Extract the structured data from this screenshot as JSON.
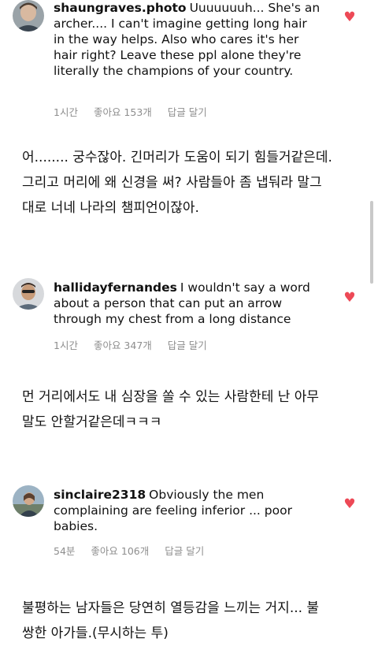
{
  "comments": [
    {
      "username": "shaungraves.photo",
      "text": "Uuuuuuuh... She's an archer.... I can't imagine getting long hair in the way helps. Also who cares it's her hair right? Leave these ppl alone they're literally the champions of your country.",
      "time": "1시간",
      "likes": "좋아요 153개",
      "reply": "답글 달기",
      "translation_lines": [
        "어........ 궁수잖아. 긴머리가 도움이 되기 힘들거같은데.",
        "그리고 머리에 왜 신경을 써? 사람들아 좀 냅둬라 말그",
        "대로 너네 나라의 챔피언이잖아."
      ]
    },
    {
      "username": "hallidayfernandes",
      "text": "I wouldn't say a word about a person that can put an arrow through my chest from a long distance",
      "time": "1시간",
      "likes": "좋아요 347개",
      "reply": "답글 달기",
      "translation_lines": [
        "먼 거리에서도 내 심장을 쏠 수 있는 사람한테 난 아무",
        "말도 안할거같은데ㅋㅋㅋ"
      ]
    },
    {
      "username": "sinclaire2318",
      "text": "Obviously the men complaining are feeling inferior ... poor babies.",
      "time": "54분",
      "likes": "좋아요 106개",
      "reply": "답글 달기",
      "translation_lines": [
        "불평하는 남자들은 당연히 열등감을 느끼는 거지... 불",
        "쌍한 아가들.(무시하는 투)"
      ]
    }
  ],
  "icons": {
    "like": "heart-icon"
  },
  "colors": {
    "heart": "#ed4956",
    "meta": "#8e8e8e"
  }
}
